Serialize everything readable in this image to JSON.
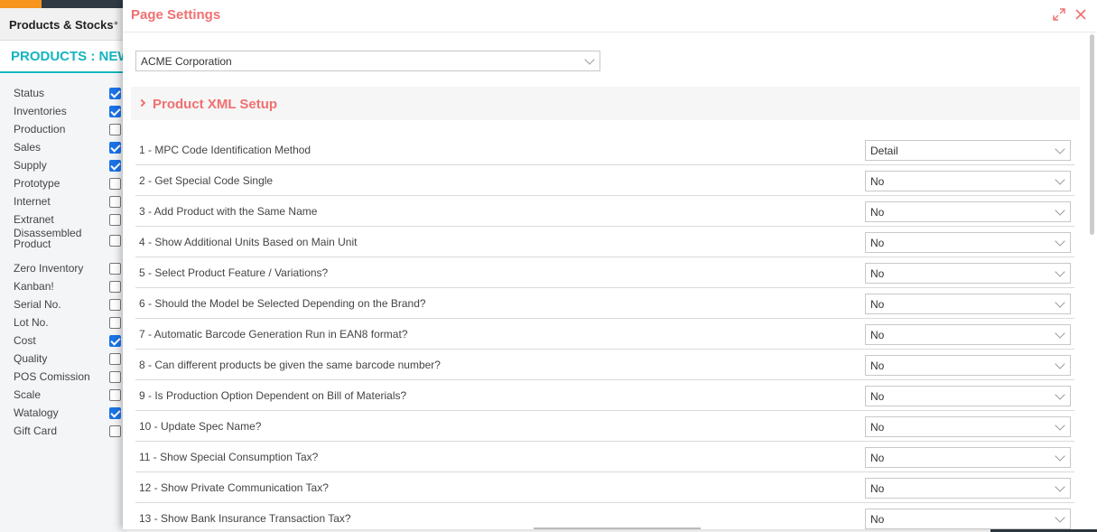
{
  "background": {
    "tab_label": "Products & Stocks",
    "tab_dot": "•",
    "heading": "PRODUCTS : NEW",
    "checklist": [
      {
        "label": "Status",
        "checked": true
      },
      {
        "label": "Inventories",
        "checked": true
      },
      {
        "label": "Production",
        "checked": false
      },
      {
        "label": "Sales",
        "checked": true
      },
      {
        "label": "Supply",
        "checked": true
      },
      {
        "label": "Prototype",
        "checked": false
      },
      {
        "label": "Internet",
        "checked": false
      },
      {
        "label": "Extranet",
        "checked": false
      },
      {
        "label": "Disassembled Product",
        "checked": false
      },
      {
        "label": "Zero Inventory",
        "checked": false
      },
      {
        "label": "Kanban!",
        "checked": false
      },
      {
        "label": "Serial No.",
        "checked": false
      },
      {
        "label": "Lot No.",
        "checked": false
      },
      {
        "label": "Cost",
        "checked": true
      },
      {
        "label": "Quality",
        "checked": false
      },
      {
        "label": "POS Comission",
        "checked": false
      },
      {
        "label": "Scale",
        "checked": false
      },
      {
        "label": "Watalogy",
        "checked": true
      },
      {
        "label": "Gift Card",
        "checked": false
      }
    ]
  },
  "modal": {
    "title": "Page Settings",
    "company_select": "ACME Corporation",
    "section_title": "Product XML Setup",
    "settings": [
      {
        "label": "1 - MPC Code Identification Method",
        "value": "Detail"
      },
      {
        "label": "2 - Get Special Code Single",
        "value": "No"
      },
      {
        "label": "3 - Add Product with the Same Name",
        "value": "No"
      },
      {
        "label": "4 - Show Additional Units Based on Main Unit",
        "value": "No"
      },
      {
        "label": "5 - Select Product Feature / Variations?",
        "value": "No"
      },
      {
        "label": "6 - Should the Model be Selected Depending on the Brand?",
        "value": "No"
      },
      {
        "label": "7 - Automatic Barcode Generation Run in EAN8 format?",
        "value": "No"
      },
      {
        "label": "8 - Can different products be given the same barcode number?",
        "value": "No"
      },
      {
        "label": "9 - Is Production Option Dependent on Bill of Materials?",
        "value": "No"
      },
      {
        "label": "10 - Update Spec Name?",
        "value": "No"
      },
      {
        "label": "11 - Show Special Consumption Tax?",
        "value": "No"
      },
      {
        "label": "12 - Show Private Communication Tax?",
        "value": "No"
      },
      {
        "label": "13 - Show Bank Insurance Transaction Tax?",
        "value": "No"
      }
    ]
  },
  "colors": {
    "accent_red": "#f07070",
    "accent_teal": "#13b5c0",
    "checkbox_blue": "#1a73e8",
    "topbar_dark": "#2f3a44",
    "topbar_orange": "#f7941d"
  },
  "icons": {
    "expand": "expand-icon",
    "close": "close-icon",
    "dropdown": "chevron-down-icon",
    "section": "chevron-right-icon"
  }
}
